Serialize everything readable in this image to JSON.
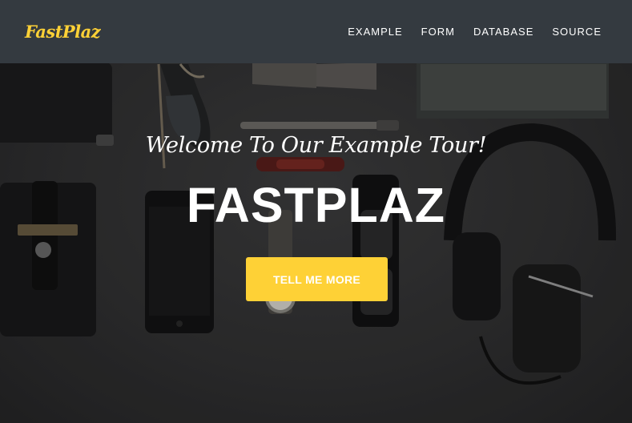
{
  "navbar": {
    "brand": "FastPlaz",
    "links": [
      {
        "label": "EXAMPLE"
      },
      {
        "label": "FORM"
      },
      {
        "label": "DATABASE"
      },
      {
        "label": "SOURCE"
      }
    ]
  },
  "hero": {
    "subtitle": "Welcome To Our Example Tour!",
    "title": "FASTPLAZ",
    "cta_label": "TELL ME MORE"
  },
  "colors": {
    "accent": "#fed136",
    "navbar_bg": "#343a40",
    "text": "#ffffff"
  }
}
